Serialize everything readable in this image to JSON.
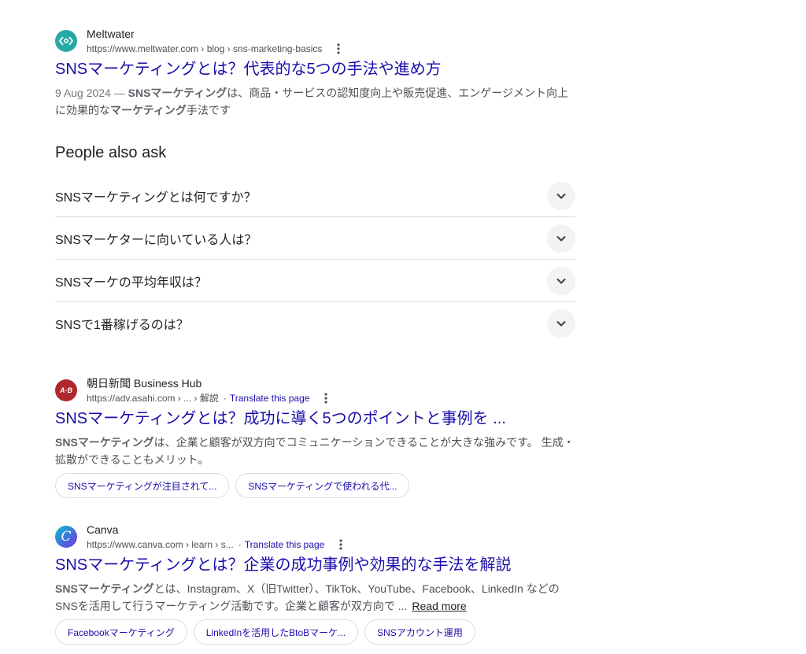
{
  "results": [
    {
      "site_name": "Meltwater",
      "url": "https://www.meltwater.com › blog › sns-marketing-basics",
      "title": "SNSマーケティングとは？代表的な5つの手法や進め方",
      "snippet": {
        "date": "9 Aug 2024 — ",
        "b1": "SNSマーケティング",
        "t1": "は、商品・サービスの認知度向上や販売促進、エンゲージメント向上に効果的な",
        "b2": "マーケティング",
        "t2": "手法です"
      },
      "favicon_color": "#27a9a6"
    },
    {
      "site_name": "朝日新聞 Business Hub",
      "url": "https://adv.asahi.com › ... › 解説",
      "translate_label": "Translate this page",
      "title": "SNSマーケティングとは？成功に導く5つのポイントと事例を ...",
      "snippet": {
        "b1": "SNSマーケティング",
        "t1": "は、企業と顧客が双方向でコミュニケーションできることが大きな強みです。 生成・拡散ができることもメリット。"
      },
      "chips": [
        "SNSマーケティングが注目されて...",
        "SNSマーケティングで使われる代..."
      ],
      "favicon_color": "#b0282d",
      "favicon_text": "A·B"
    },
    {
      "site_name": "Canva",
      "url": "https://www.canva.com › learn › s...",
      "translate_label": "Translate this page",
      "title": "SNSマーケティングとは？企業の成功事例や効果的な手法を解説",
      "snippet": {
        "b1": "SNSマーケティング",
        "t1": "とは、Instagram、X（旧Twitter）、TikTok、YouTube、Facebook、LinkedIn などのSNSを活用して行うマーケティング活動です。企業と顧客が双方向で ...",
        "read_more": "Read more"
      },
      "chips": [
        "Facebookマーケティング",
        "LinkedInを活用したBtoBマーケ...",
        "SNSアカウント運用"
      ],
      "favicon_text": "C"
    }
  ],
  "people_also_ask": {
    "title": "People also ask",
    "questions": [
      "SNSマーケティングとは何ですか？",
      "SNSマーケターに向いている人は？",
      "SNSマーケの平均年収は？",
      "SNSで1番稼げるのは？"
    ]
  },
  "colors": {
    "link": "#1a0dab",
    "snippet": "#4d5156",
    "border": "#dadce0"
  }
}
